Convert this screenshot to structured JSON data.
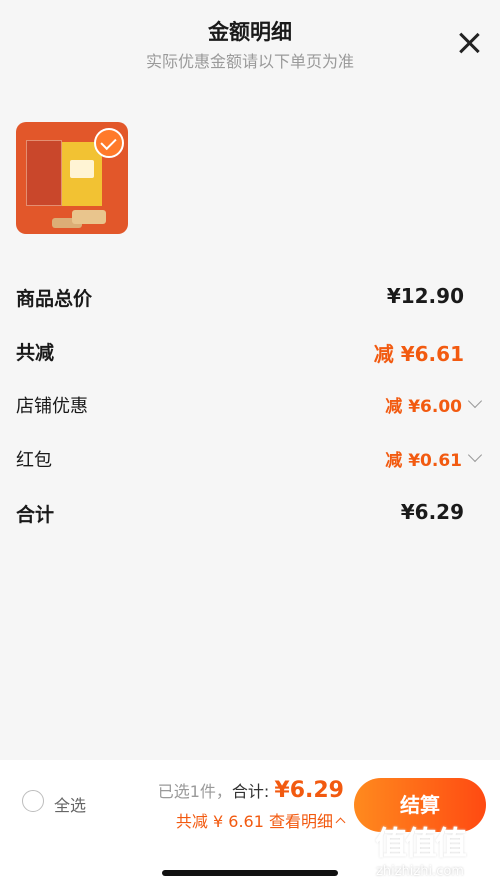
{
  "header": {
    "title": "金额明细",
    "subtitle": "实际优惠金额请以下单页为准"
  },
  "rows": {
    "total_label": "商品总价",
    "total_value": "¥12.90",
    "reduce_label": "共减",
    "reduce_value": "减 ¥6.61",
    "shop_label": "店铺优惠",
    "shop_value": "减 ¥6.00",
    "redpack_label": "红包",
    "redpack_value": "减 ¥0.61",
    "sum_label": "合计",
    "sum_value": "¥6.29"
  },
  "footer": {
    "select_all": "全选",
    "selected": "已选1件，",
    "total_label": "合计:",
    "total_amount": "¥6.29",
    "reduce_detail": "共减 ¥ 6.61 查看明细",
    "checkout": "结算"
  },
  "watermark": {
    "logo": "值值值",
    "text": "zhizhizhi.com"
  },
  "colors": {
    "accent": "#f25a10",
    "button_start": "#ff8a1e",
    "button_end": "#ff4a12"
  }
}
